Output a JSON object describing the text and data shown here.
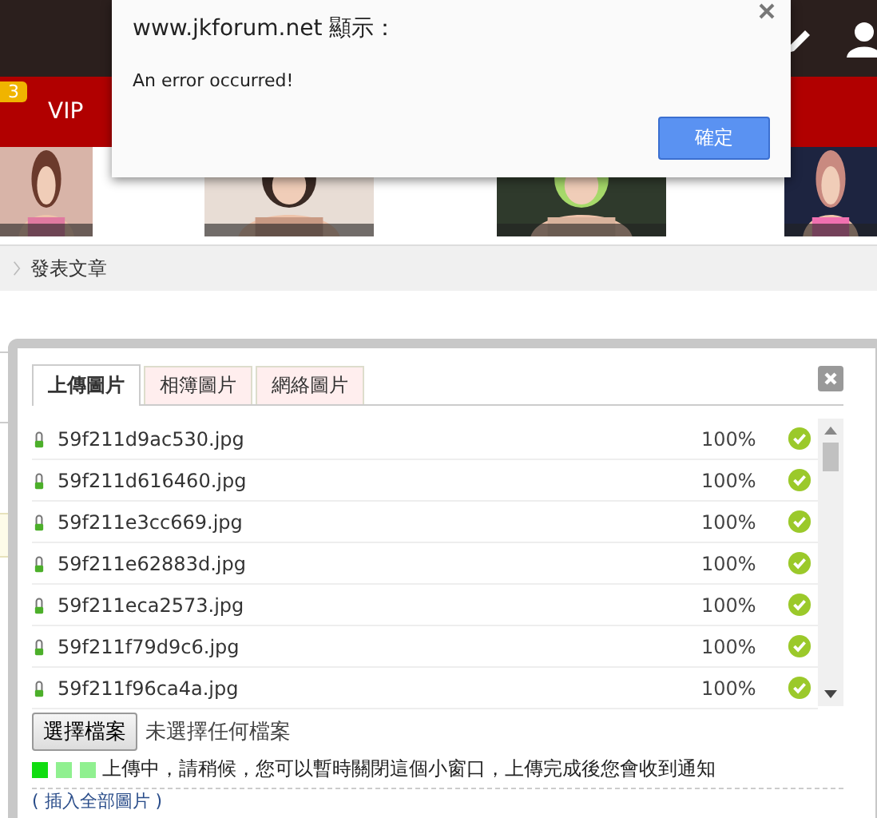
{
  "alert": {
    "title": "www.jkforum.net 顯示：",
    "message": "An error occurred!",
    "button": "確定"
  },
  "nav": {
    "badge": "3",
    "items": [
      "VIP"
    ]
  },
  "breadcrumb": {
    "label": "發表文章"
  },
  "upload_dialog": {
    "tabs": [
      {
        "label": "上傳圖片",
        "selected": true
      },
      {
        "label": "相簿圖片",
        "selected": false
      },
      {
        "label": "網絡圖片",
        "selected": false
      }
    ],
    "files": [
      {
        "name": "59f211d9ac530.jpg",
        "percent": "100%",
        "done": true
      },
      {
        "name": "59f211d616460.jpg",
        "percent": "100%",
        "done": true
      },
      {
        "name": "59f211e3cc669.jpg",
        "percent": "100%",
        "done": true
      },
      {
        "name": "59f211e62883d.jpg",
        "percent": "100%",
        "done": true
      },
      {
        "name": "59f211eca2573.jpg",
        "percent": "100%",
        "done": true
      },
      {
        "name": "59f211f79d9c6.jpg",
        "percent": "100%",
        "done": true
      },
      {
        "name": "59f211f96ca4a.jpg",
        "percent": "100%",
        "done": true
      }
    ],
    "choose_button": "選擇檔案",
    "no_file": "未選擇任何檔案",
    "progress_dots": [
      {
        "on": true
      },
      {
        "on": false
      },
      {
        "on": false
      }
    ],
    "status": "上傳中，請稍候，您可以暫時關閉這個小窗口，上傳完成後您會收到通知",
    "link": "( 插入全部圖片 )"
  }
}
